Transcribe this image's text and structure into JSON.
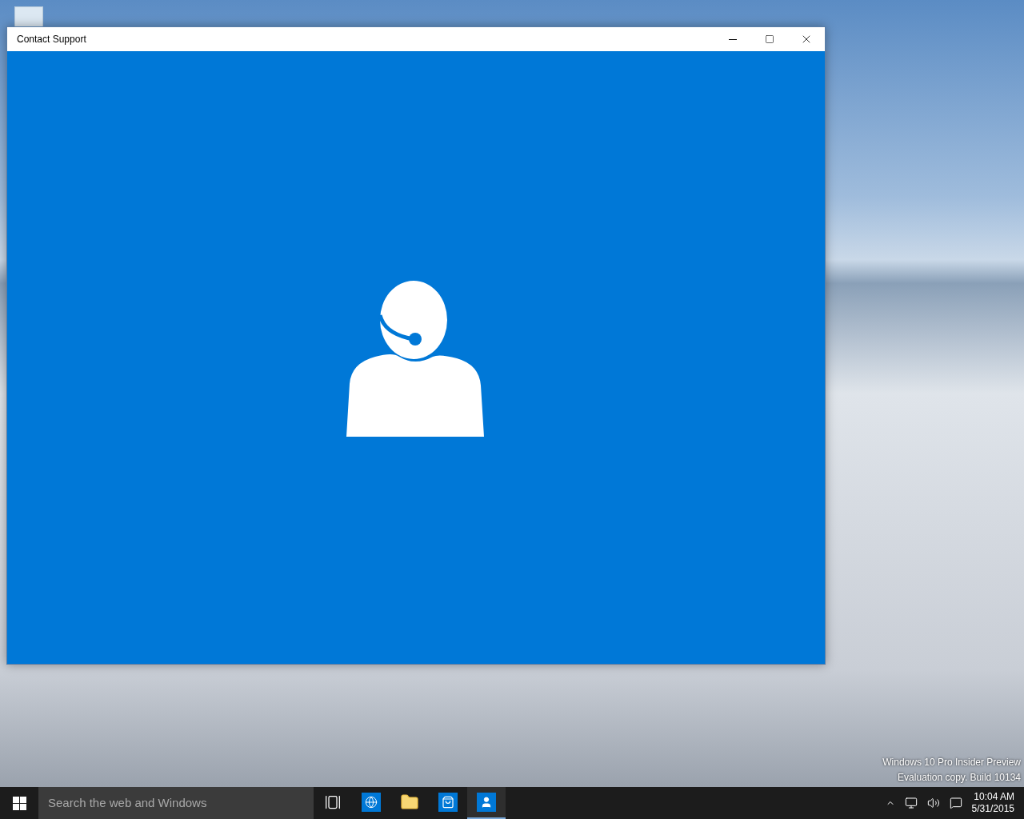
{
  "window": {
    "title": "Contact Support"
  },
  "taskbar": {
    "search": {
      "placeholder": "Search the web and Windows"
    },
    "apps": [
      {
        "kind": "task-view",
        "selected": false
      },
      {
        "kind": "browser",
        "selected": false
      },
      {
        "kind": "folder",
        "selected": false
      },
      {
        "kind": "store",
        "selected": false
      },
      {
        "kind": "support",
        "selected": true
      }
    ],
    "clock": {
      "time": "10:04 AM",
      "date": "5/31/2015"
    }
  },
  "desktop_notice": [
    "Windows 10 Pro Insider Preview",
    "Evaluation copy. Build 10134"
  ]
}
